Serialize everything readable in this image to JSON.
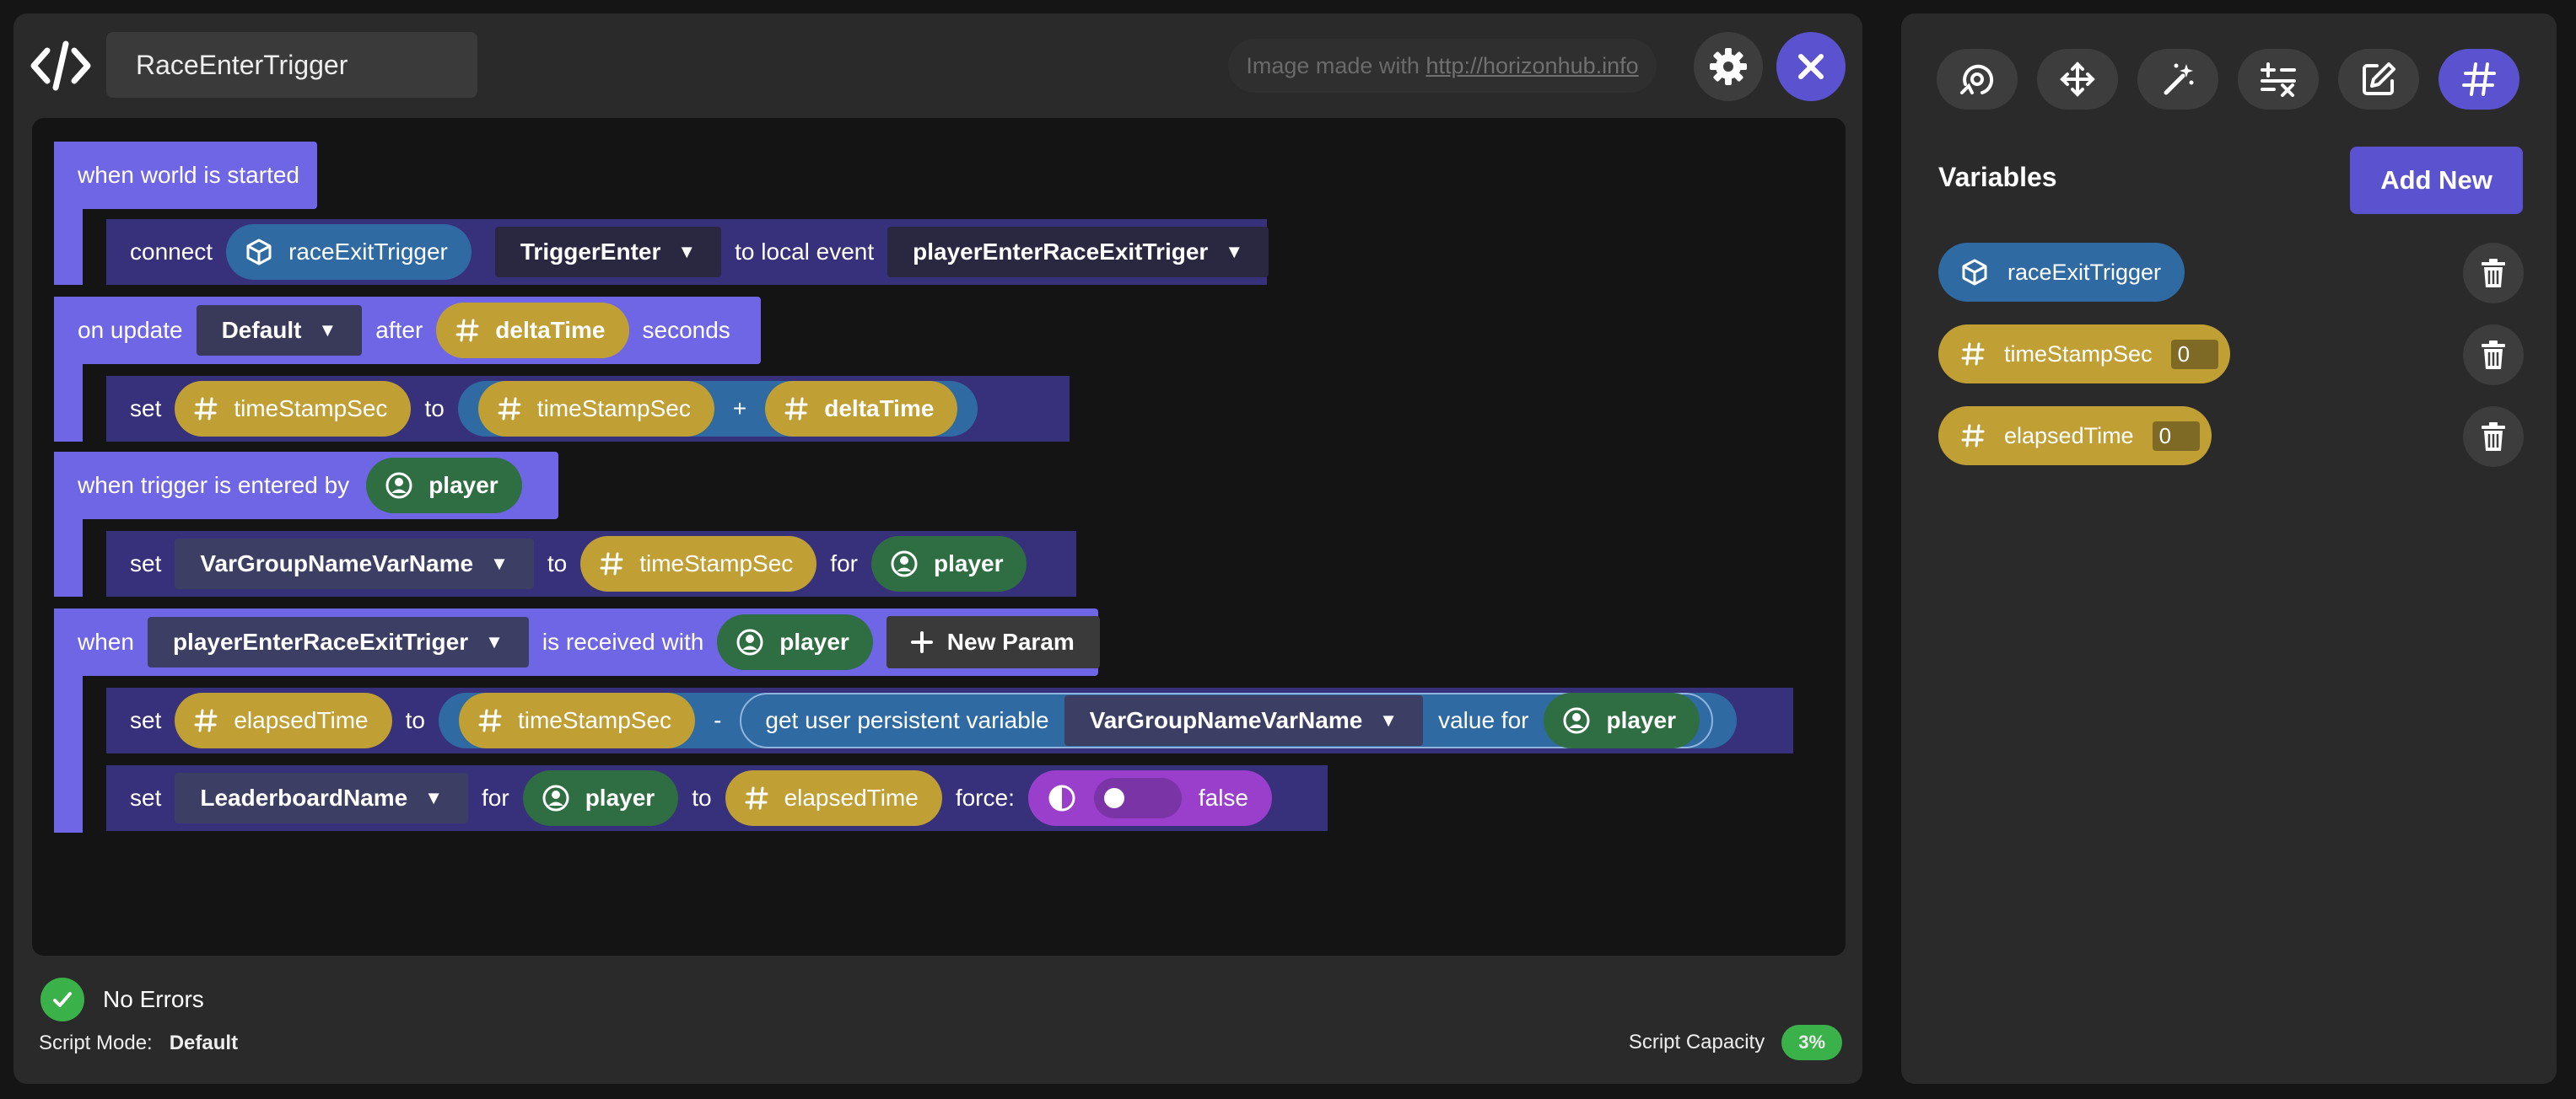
{
  "header": {
    "script_name": "RaceEnterTrigger",
    "watermark_prefix": "Image made with ",
    "watermark_link": "http://horizonhub.info"
  },
  "blocks": {
    "b1": {
      "hat": "when world is started",
      "connect": "connect",
      "object": "raceExitTrigger",
      "event_type": "TriggerEnter",
      "to_local_event": "to local event",
      "local_event": "playerEnterRaceExitTriger"
    },
    "b2": {
      "on_update": "on update",
      "update_mode": "Default",
      "after": "after",
      "delta": "deltaTime",
      "seconds": "seconds",
      "set": "set",
      "target": "timeStampSec",
      "to": "to",
      "lhs": "timeStampSec",
      "op": "+",
      "rhs": "deltaTime"
    },
    "b3": {
      "hat": "when trigger is entered by",
      "player": "player",
      "set": "set",
      "group": "VarGroupNameVarName",
      "to": "to",
      "value": "timeStampSec",
      "for": "for",
      "player2": "player"
    },
    "b4": {
      "when": "when",
      "event": "playerEnterRaceExitTriger",
      "received": "is received with",
      "player": "player",
      "new_param": "New Param",
      "set1": "set",
      "target1": "elapsedTime",
      "to1": "to",
      "lhs": "timeStampSec",
      "op": "-",
      "get_var": "get user persistent variable",
      "group": "VarGroupNameVarName",
      "value_for": "value for",
      "player2": "player",
      "set2": "set",
      "leaderboard": "LeaderboardName",
      "for": "for",
      "player3": "player",
      "to2": "to",
      "value2": "elapsedTime",
      "force": "force:",
      "bool": "false"
    }
  },
  "footer": {
    "errors": "No Errors",
    "mode_label": "Script Mode:",
    "mode_value": "Default",
    "capacity_label": "Script Capacity",
    "capacity_value": "3%"
  },
  "sidebar": {
    "tools": [
      "rotate-icon",
      "move-icon",
      "magic-wand-icon",
      "math-icon",
      "edit-icon",
      "hash-icon"
    ],
    "active_tool": "hash-icon",
    "variables_title": "Variables",
    "add_new": "Add New",
    "variables": [
      {
        "name": "raceExitTrigger",
        "type": "object"
      },
      {
        "name": "timeStampSec",
        "type": "number",
        "value": "0"
      },
      {
        "name": "elapsedTime",
        "type": "number",
        "value": "0"
      }
    ]
  },
  "colors": {
    "block_hat": "#6f66e6",
    "block_body": "#37307a",
    "object": "#2f6aa3",
    "number": "#c0a034",
    "player": "#2f6e42",
    "boolean": "#9a3fcc",
    "accent": "#5b52cf",
    "ok": "#3bb14a"
  }
}
